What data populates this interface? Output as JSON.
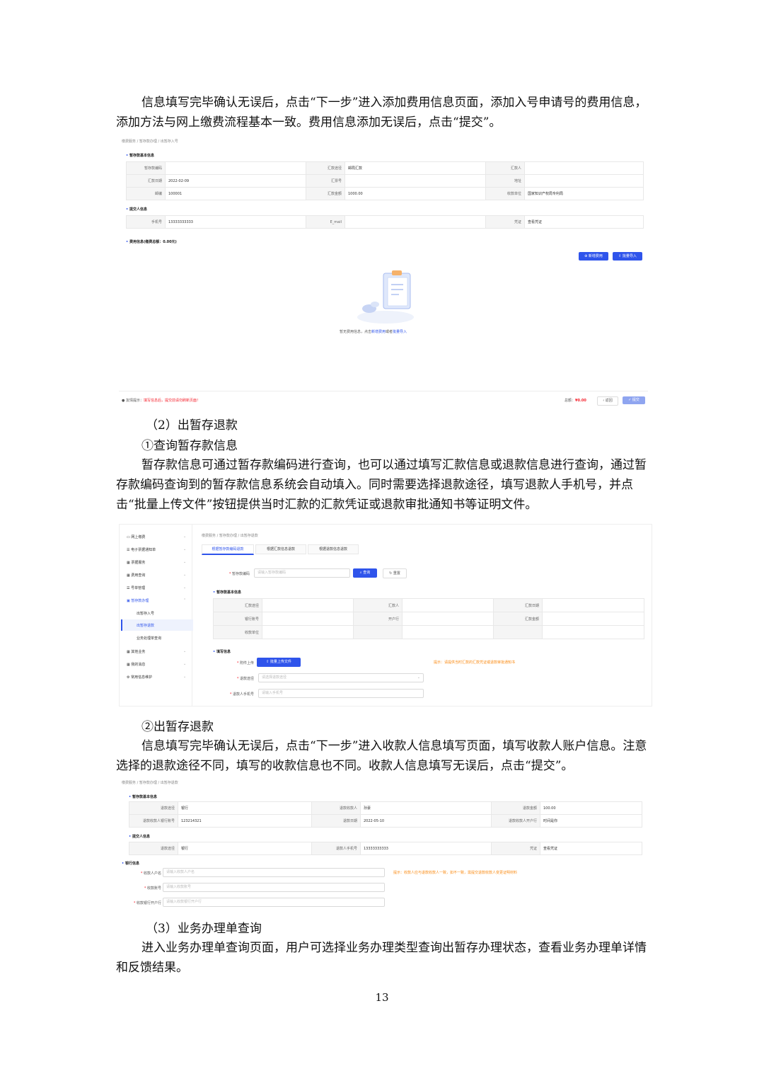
{
  "text": {
    "p1": "信息填写完毕确认无误后，点击“下一步”进入添加费用信息页面，添加入号申请号的费用信息，添加方法与网上缴费流程基本一致。费用信息添加无误后，点击“提交”。",
    "h2": "（2）出暂存退款",
    "h2a": "①查询暂存款信息",
    "p2": "暂存款信息可通过暂存款编码进行查询，也可以通过填写汇款信息或退款信息进行查询，通过暂存款编码查询到的暂存款信息系统会自动填入。同时需要选择退款途径，填写退款人手机号，并点击“批量上传文件”按钮提供当时汇款的汇款凭证或退款审批通知书等证明文件。",
    "h2b": "②出暂存退款",
    "p3": "信息填写完毕确认无误后，点击“下一步”进入收款人信息填写页面，填写收款人账户信息。注意选择的退款途径不同，填写的收款信息也不同。收款人信息填写无误后，点击“提交”。",
    "h3": "（3）业务办理单查询",
    "p4": "进入业务办理单查询页面，用户可选择业务办理类型查询出暂存办理状态，查看业务办理单详情和反馈结果。",
    "page_number": "13"
  },
  "shot1": {
    "breadcrumb": "缴费服务 / 暂存款办理 / 出暂存入号",
    "section_basic": "暂存款基本信息",
    "rows": [
      [
        "暂存款编码",
        "",
        "汇款途径",
        "邮局汇款",
        "汇款人",
        ""
      ],
      [
        "汇款日期",
        "2022-02-09",
        "汇票号",
        "",
        "地址",
        ""
      ],
      [
        "邮编",
        "100001",
        "汇款金额",
        "1000.00",
        "收款单位",
        "国家知识产权局专利局"
      ]
    ],
    "section_submitter": "提交人信息",
    "submitter_row": [
      "手机号",
      "13333333333",
      "E_mail",
      "",
      "凭证",
      "查看凭证"
    ],
    "section_fee": "费用信息(缴费总额：0.00元)",
    "btn_add": "新增费用",
    "btn_import": "批量导入",
    "empty_text": "暂无费用信息，点击",
    "empty_link1": "新增费用",
    "empty_or": "或者",
    "empty_link2": "批量导入",
    "footer_tip_label": "友情提示：",
    "footer_tip": "填写信息后，提交前请勿刷新页面！",
    "total_label": "总额：",
    "total_value": "¥0.00",
    "btn_back": "返回",
    "btn_submit": "提交"
  },
  "shot2": {
    "sidebar": [
      "网上缴费",
      "电子票据通知单",
      "票据服务",
      "费用查询",
      "号单管理",
      "暂存款办理",
      "出暂存入号",
      "出暂存退款",
      "业务处理单查询",
      "其他业务",
      "我的消息",
      "常用信息维护"
    ],
    "breadcrumb": "缴费服务 / 暂存款办理 / 出暂存退款",
    "tabs": [
      "根据暂存款编码退款",
      "根据汇款信息退款",
      "根据退款信息退款"
    ],
    "code_label": "暂存款编码",
    "code_placeholder": "请输入暂存款编码",
    "btn_query": "查询",
    "btn_reset": "重置",
    "section_basic": "暂存款基本信息",
    "rows": [
      [
        "汇款途径",
        "",
        "汇款人",
        "",
        "汇款日期",
        ""
      ],
      [
        "银行账号",
        "",
        "开户行",
        "",
        "汇款金额",
        ""
      ],
      [
        "收款单位",
        "",
        "",
        "",
        "",
        ""
      ]
    ],
    "section_fill": "填写信息",
    "attach_label": "附件上传",
    "btn_upload": "批量上传文件",
    "upload_tip": "提示：请提供当时汇款的汇款凭证或退款审批通知书",
    "route_label": "退款途径",
    "route_placeholder": "请选择退款途径",
    "phone_label": "退款人手机号",
    "phone_placeholder": "请输入手机号"
  },
  "shot3": {
    "breadcrumb": "缴费服务 / 暂存款办理 / 出暂存退款",
    "section_basic": "暂存款基本信息",
    "rows": [
      [
        "退款途径",
        "银行",
        "退款收款人",
        "孙豪",
        "退款金额",
        "100.00"
      ],
      [
        "退款收款人银行账号",
        "123214321",
        "退款日期",
        "2022-05-10",
        "退款收款人开户行",
        "时间是你"
      ]
    ],
    "section_submitter": "提交人信息",
    "submitter_row": [
      "退款途径",
      "银行",
      "退款人手机号",
      "13333333333",
      "凭证",
      "查看凭证"
    ],
    "section_bank": "银行信息",
    "fields": [
      {
        "label": "收款人户名",
        "placeholder": "请输入收款人户名"
      },
      {
        "label": "收款账号",
        "placeholder": "请输入收款账号"
      },
      {
        "label": "收款银行开户行",
        "placeholder": "请输入收款银行开户行"
      }
    ],
    "bank_tip": "提示：收款人应与退款收款人一致，如不一致，需提交退款收款人变更证明材料"
  }
}
